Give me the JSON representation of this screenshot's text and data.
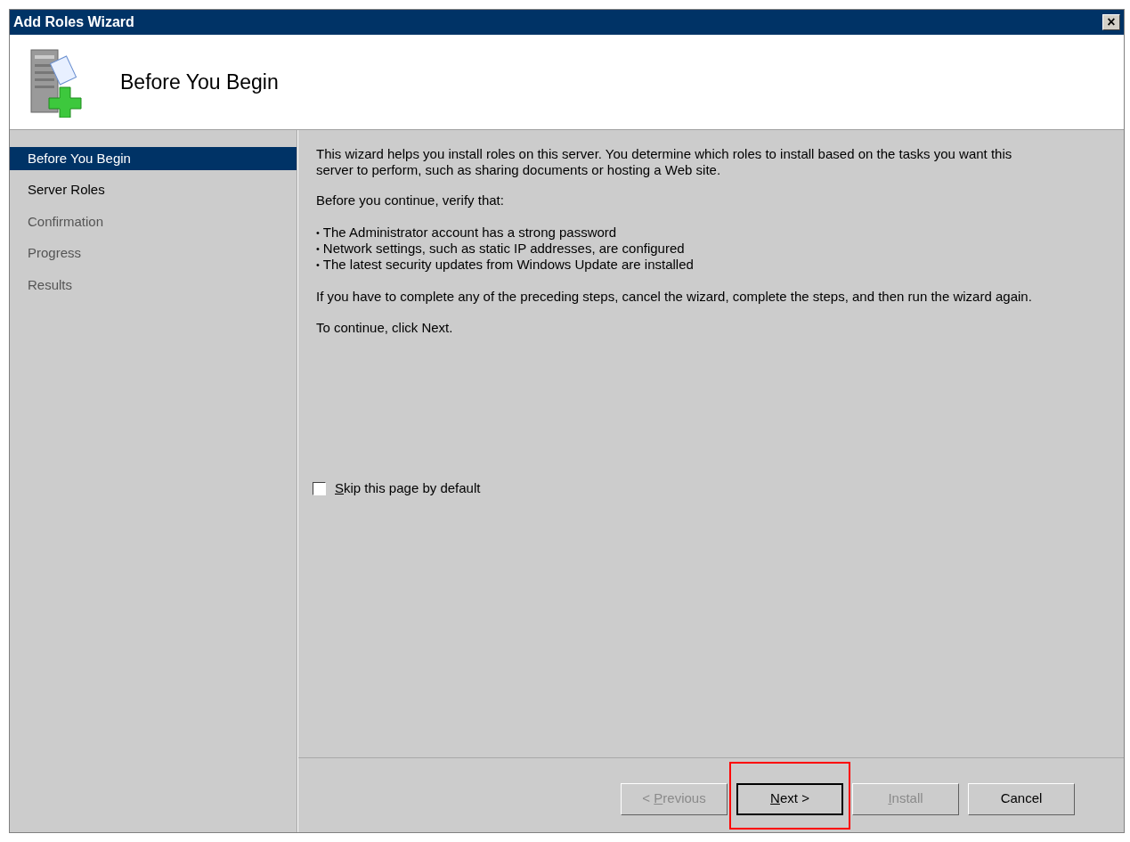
{
  "window": {
    "title": "Add Roles Wizard",
    "close": "×"
  },
  "header": {
    "title": "Before You Begin"
  },
  "steps": [
    {
      "label": "Before You Begin",
      "selected": true,
      "disabled": false
    },
    {
      "label": "Server Roles",
      "selected": false,
      "disabled": false
    },
    {
      "label": "Confirmation",
      "selected": false,
      "disabled": true
    },
    {
      "label": "Progress",
      "selected": false,
      "disabled": true
    },
    {
      "label": "Results",
      "selected": false,
      "disabled": true
    }
  ],
  "content": {
    "intro": "This wizard helps you install roles on this server. You determine which roles to install based on the tasks you want this server to perform, such as sharing documents or hosting a Web site.",
    "verify": "Before you continue, verify that:",
    "bullets": [
      "The Administrator account has a strong password",
      "Network settings, such as static IP addresses, are configured",
      "The latest security updates from Windows Update are installed"
    ],
    "bullet_mark": "•",
    "note": "If you have to complete any of the preceding steps, cancel the wizard, complete the steps, and then run the wizard again.",
    "continue": "To continue, click Next."
  },
  "skip_checkbox": {
    "key": "S",
    "after": "kip this page by default",
    "checked": false
  },
  "buttons": [
    {
      "before": "< ",
      "key": "P",
      "after": "revious",
      "disabled": true,
      "default": false,
      "highlighted": false
    },
    {
      "key": "N",
      "after": "ext >",
      "disabled": false,
      "default": true,
      "highlighted": true
    },
    {
      "key": "I",
      "after": "nstall",
      "disabled": true,
      "default": false,
      "highlighted": false
    },
    {
      "before": "Cancel",
      "disabled": false,
      "default": false,
      "highlighted": false
    }
  ]
}
